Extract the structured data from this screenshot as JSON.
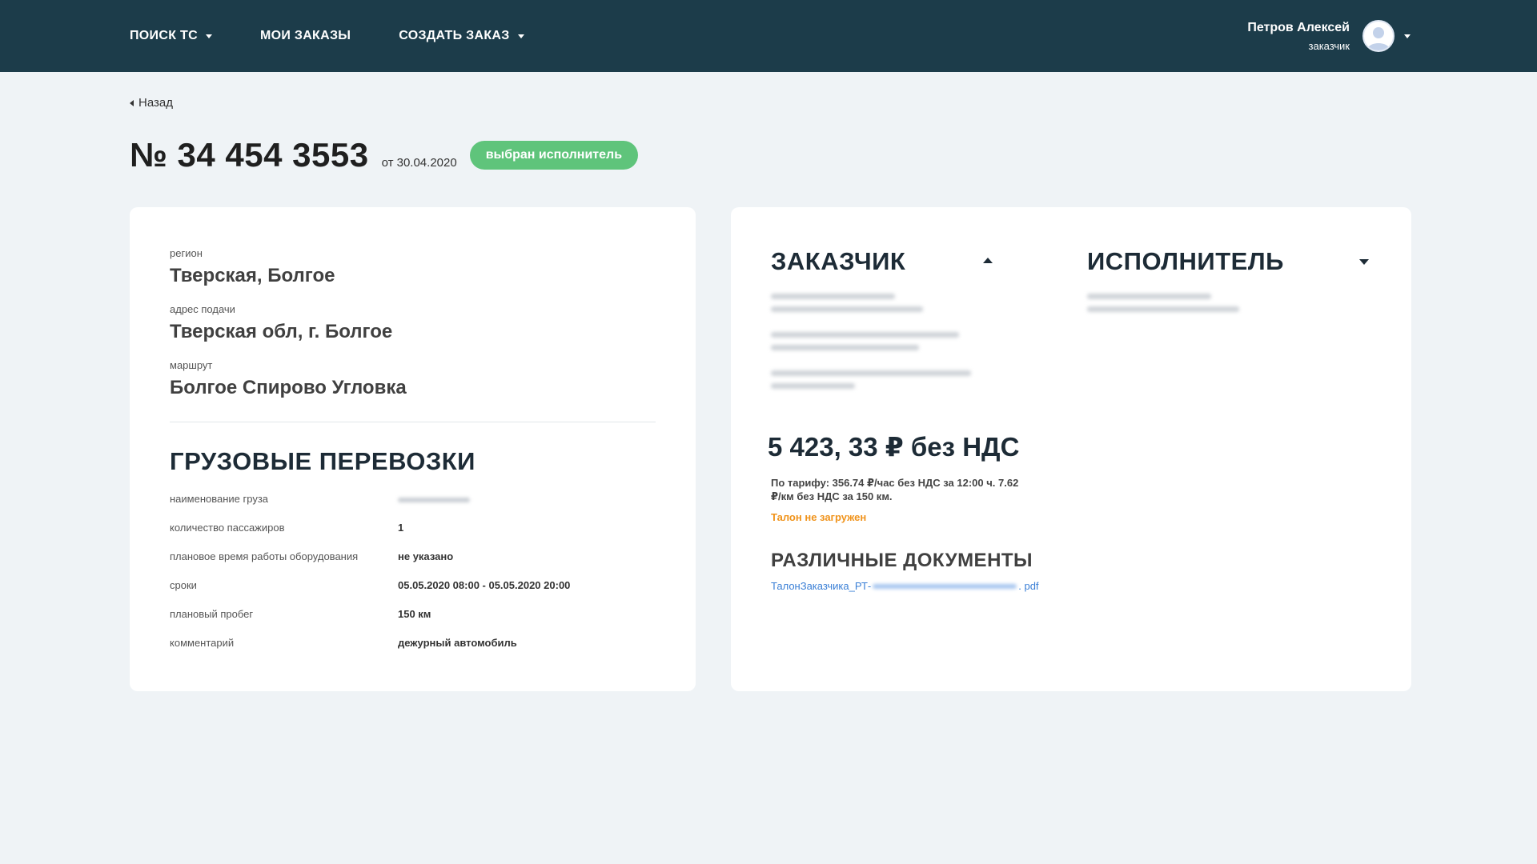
{
  "header": {
    "nav": [
      {
        "label": "ПОИСК ТС"
      },
      {
        "label": "МОИ ЗАКАЗЫ"
      },
      {
        "label": "СОЗДАТЬ ЗАКАЗ"
      }
    ],
    "user": {
      "name": "Петров Алексей",
      "role": "заказчик"
    }
  },
  "back_label": "Назад",
  "order": {
    "number": "№ 34 454 3553",
    "date": "от 30.04.2020",
    "status": "выбран исполнитель"
  },
  "left": {
    "region_label": "регион",
    "region_value": "Тверская, Болгое",
    "address_label": "адрес подачи",
    "address_value": "Тверская обл, г. Болгое",
    "route_label": "маршрут",
    "route_value": "Болгое Спирово Угловка",
    "section_title": "ГРУЗОВЫЕ ПЕРЕВОЗКИ",
    "details": [
      {
        "k": "наименование груза",
        "v": ""
      },
      {
        "k": "количество пассажиров",
        "v": "1"
      },
      {
        "k": "плановое время работы оборудования",
        "v": "не указано"
      },
      {
        "k": "сроки",
        "v": "05.05.2020 08:00 - 05.05.2020 20:00"
      },
      {
        "k": "плановый пробег",
        "v": "150 км"
      },
      {
        "k": "комментарий",
        "v": "дежурный автомобиль"
      }
    ]
  },
  "right": {
    "customer_title": "ЗАКАЗЧИК",
    "executor_title": "ИСПОЛНИТЕЛЬ",
    "price": "5 423, 33 ₽ без НДС",
    "tariff": "По тарифу: 356.74 ₽/час без НДС за 12:00 ч. 7.62 ₽/км без НДС за 150 км.",
    "warning": "Талон не загружен",
    "docs_title": "РАЗЛИЧНЫЕ ДОКУМЕНТЫ",
    "doc_prefix": "ТалонЗаказчика_РТ-",
    "doc_suffix": ". pdf"
  },
  "colors": {
    "header_bg": "#1c3c4a",
    "page_bg": "#eff3f6",
    "badge": "#5fc47b",
    "warning": "#f0931b",
    "link": "#3a7fd6"
  },
  "icons": [
    "caret-down-icon",
    "user-avatar-icon",
    "back-arrow-icon",
    "caret-up-icon"
  ]
}
